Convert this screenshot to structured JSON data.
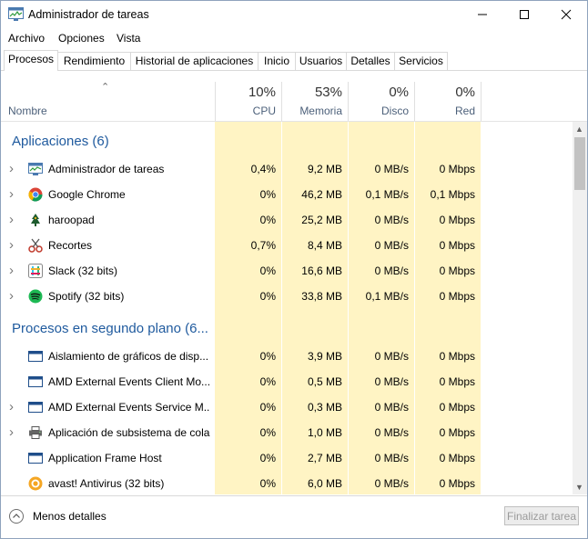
{
  "window": {
    "title": "Administrador de tareas",
    "icon": "task-manager-icon"
  },
  "menu": [
    "Archivo",
    "Opciones",
    "Vista"
  ],
  "tabs": [
    {
      "label": "Procesos",
      "active": true
    },
    {
      "label": "Rendimiento",
      "active": false
    },
    {
      "label": "Historial de aplicaciones",
      "active": false
    },
    {
      "label": "Inicio",
      "active": false
    },
    {
      "label": "Usuarios",
      "active": false
    },
    {
      "label": "Detalles",
      "active": false
    },
    {
      "label": "Servicios",
      "active": false
    }
  ],
  "columns": {
    "name": {
      "label": "Nombre"
    },
    "cpu": {
      "pct": "10%",
      "label": "CPU"
    },
    "memory": {
      "pct": "53%",
      "label": "Memoria"
    },
    "disk": {
      "pct": "0%",
      "label": "Disco"
    },
    "network": {
      "pct": "0%",
      "label": "Red"
    }
  },
  "groups": {
    "apps": "Aplicaciones (6)",
    "background": "Procesos en segundo plano (6..."
  },
  "apps": [
    {
      "name": "Administrador de tareas",
      "icon": "task-manager-icon",
      "expandable": true,
      "cpu": "0,4%",
      "memory": "9,2 MB",
      "disk": "0 MB/s",
      "network": "0 Mbps"
    },
    {
      "name": "Google Chrome",
      "icon": "chrome-icon",
      "expandable": true,
      "cpu": "0%",
      "memory": "46,2 MB",
      "disk": "0,1 MB/s",
      "network": "0,1 Mbps"
    },
    {
      "name": "haroopad",
      "icon": "haroopad-icon",
      "expandable": true,
      "cpu": "0%",
      "memory": "25,2 MB",
      "disk": "0 MB/s",
      "network": "0 Mbps"
    },
    {
      "name": "Recortes",
      "icon": "snipping-tool-icon",
      "expandable": true,
      "cpu": "0,7%",
      "memory": "8,4 MB",
      "disk": "0 MB/s",
      "network": "0 Mbps"
    },
    {
      "name": "Slack (32 bits)",
      "icon": "slack-icon",
      "expandable": true,
      "cpu": "0%",
      "memory": "16,6 MB",
      "disk": "0 MB/s",
      "network": "0 Mbps"
    },
    {
      "name": "Spotify (32 bits)",
      "icon": "spotify-icon",
      "expandable": true,
      "cpu": "0%",
      "memory": "33,8 MB",
      "disk": "0,1 MB/s",
      "network": "0 Mbps"
    }
  ],
  "background": [
    {
      "name": "Aislamiento de gráficos de disp...",
      "icon": "process-window-icon",
      "expandable": false,
      "cpu": "0%",
      "memory": "3,9 MB",
      "disk": "0 MB/s",
      "network": "0 Mbps"
    },
    {
      "name": "AMD External Events Client Mo...",
      "icon": "process-window-icon",
      "expandable": false,
      "cpu": "0%",
      "memory": "0,5 MB",
      "disk": "0 MB/s",
      "network": "0 Mbps"
    },
    {
      "name": "AMD External Events Service M...",
      "icon": "process-window-icon",
      "expandable": true,
      "cpu": "0%",
      "memory": "0,3 MB",
      "disk": "0 MB/s",
      "network": "0 Mbps"
    },
    {
      "name": "Aplicación de subsistema de cola",
      "icon": "printer-icon",
      "expandable": true,
      "cpu": "0%",
      "memory": "1,0 MB",
      "disk": "0 MB/s",
      "network": "0 Mbps"
    },
    {
      "name": "Application Frame Host",
      "icon": "process-window-icon",
      "expandable": false,
      "cpu": "0%",
      "memory": "2,7 MB",
      "disk": "0 MB/s",
      "network": "0 Mbps"
    },
    {
      "name": "avast! Antivirus (32 bits)",
      "icon": "avast-icon",
      "expandable": false,
      "cpu": "0%",
      "memory": "6,0 MB",
      "disk": "0 MB/s",
      "network": "0 Mbps"
    }
  ],
  "footer": {
    "less_details": "Menos detalles",
    "end_task": "Finalizar tarea"
  },
  "colors": {
    "heat_light": "#fff4c4",
    "heat_mid": "#f9ecb0",
    "heat_dark": "#f4e29a",
    "group_text": "#1f5a9e"
  }
}
